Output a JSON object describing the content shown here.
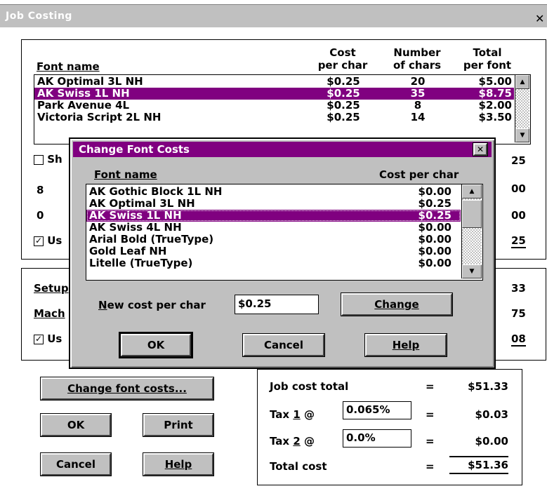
{
  "window": {
    "title": "Job Costing",
    "close_glyph": "✕"
  },
  "font_table": {
    "headers": {
      "name": "Font name",
      "cost_line1": "Cost",
      "cost_line2": "per char",
      "chars_line1": "Number",
      "chars_line2": "of chars",
      "total_line1": "Total",
      "total_line2": "per font"
    },
    "rows": [
      {
        "name": "AK Optimal 3L NH",
        "cost": "$0.25",
        "chars": "20",
        "total": "$5.00"
      },
      {
        "name": "AK Swiss 1L NH",
        "cost": "$0.25",
        "chars": "35",
        "total": "$8.75"
      },
      {
        "name": "Park Avenue 4L",
        "cost": "$0.25",
        "chars": "8",
        "total": "$2.00"
      },
      {
        "name": "Victoria Script 2L NH",
        "cost": "$0.25",
        "chars": "14",
        "total": "$3.50"
      }
    ]
  },
  "behind": {
    "show_label": "Sh",
    "val_8": "8",
    "val_0": "0",
    "use_label": "Us",
    "right_25": "25",
    "right_00a": "00",
    "right_00b": "00",
    "right_25b": "25",
    "setup_label": "Setup",
    "mach_label": "Mach",
    "use2_label": "Us",
    "right_33": "33",
    "right_75": "75",
    "right_08": "08"
  },
  "dialog": {
    "title": "Change Font Costs",
    "close_glyph": "✕",
    "col_name": "Font name",
    "col_cost": "Cost per char",
    "items": [
      {
        "name": "AK Gothic Block 1L NH",
        "cost": "$0.00"
      },
      {
        "name": "AK Optimal 3L NH",
        "cost": "$0.25"
      },
      {
        "name": "AK Swiss 1L NH",
        "cost": "$0.25"
      },
      {
        "name": "AK Swiss 4L NH",
        "cost": "$0.00"
      },
      {
        "name": "Arial Bold (TrueType)",
        "cost": "$0.00"
      },
      {
        "name": "Gold Leaf NH",
        "cost": "$0.00"
      },
      {
        "name": "Litelle (TrueType)",
        "cost": "$0.00"
      }
    ],
    "new_cost_label": "New cost per char",
    "new_cost_value": "$0.25",
    "change_btn": "Change",
    "ok_btn": "OK",
    "cancel_btn": "Cancel",
    "help_btn": "Help"
  },
  "buttons": {
    "change_font_costs": "Change font costs...",
    "ok": "OK",
    "print": "Print",
    "cancel": "Cancel",
    "help": "Help"
  },
  "totals": {
    "job_cost_label": "Job cost total",
    "eq": "=",
    "job_cost_value": "$51.33",
    "tax1_label": "Tax 1 @",
    "tax1_rate": "0.065%",
    "tax1_value": "$0.03",
    "tax2_label": "Tax 2 @",
    "tax2_rate": "0.0%",
    "tax2_value": "$0.00",
    "total_label": "Total cost",
    "total_value": "$51.36"
  }
}
